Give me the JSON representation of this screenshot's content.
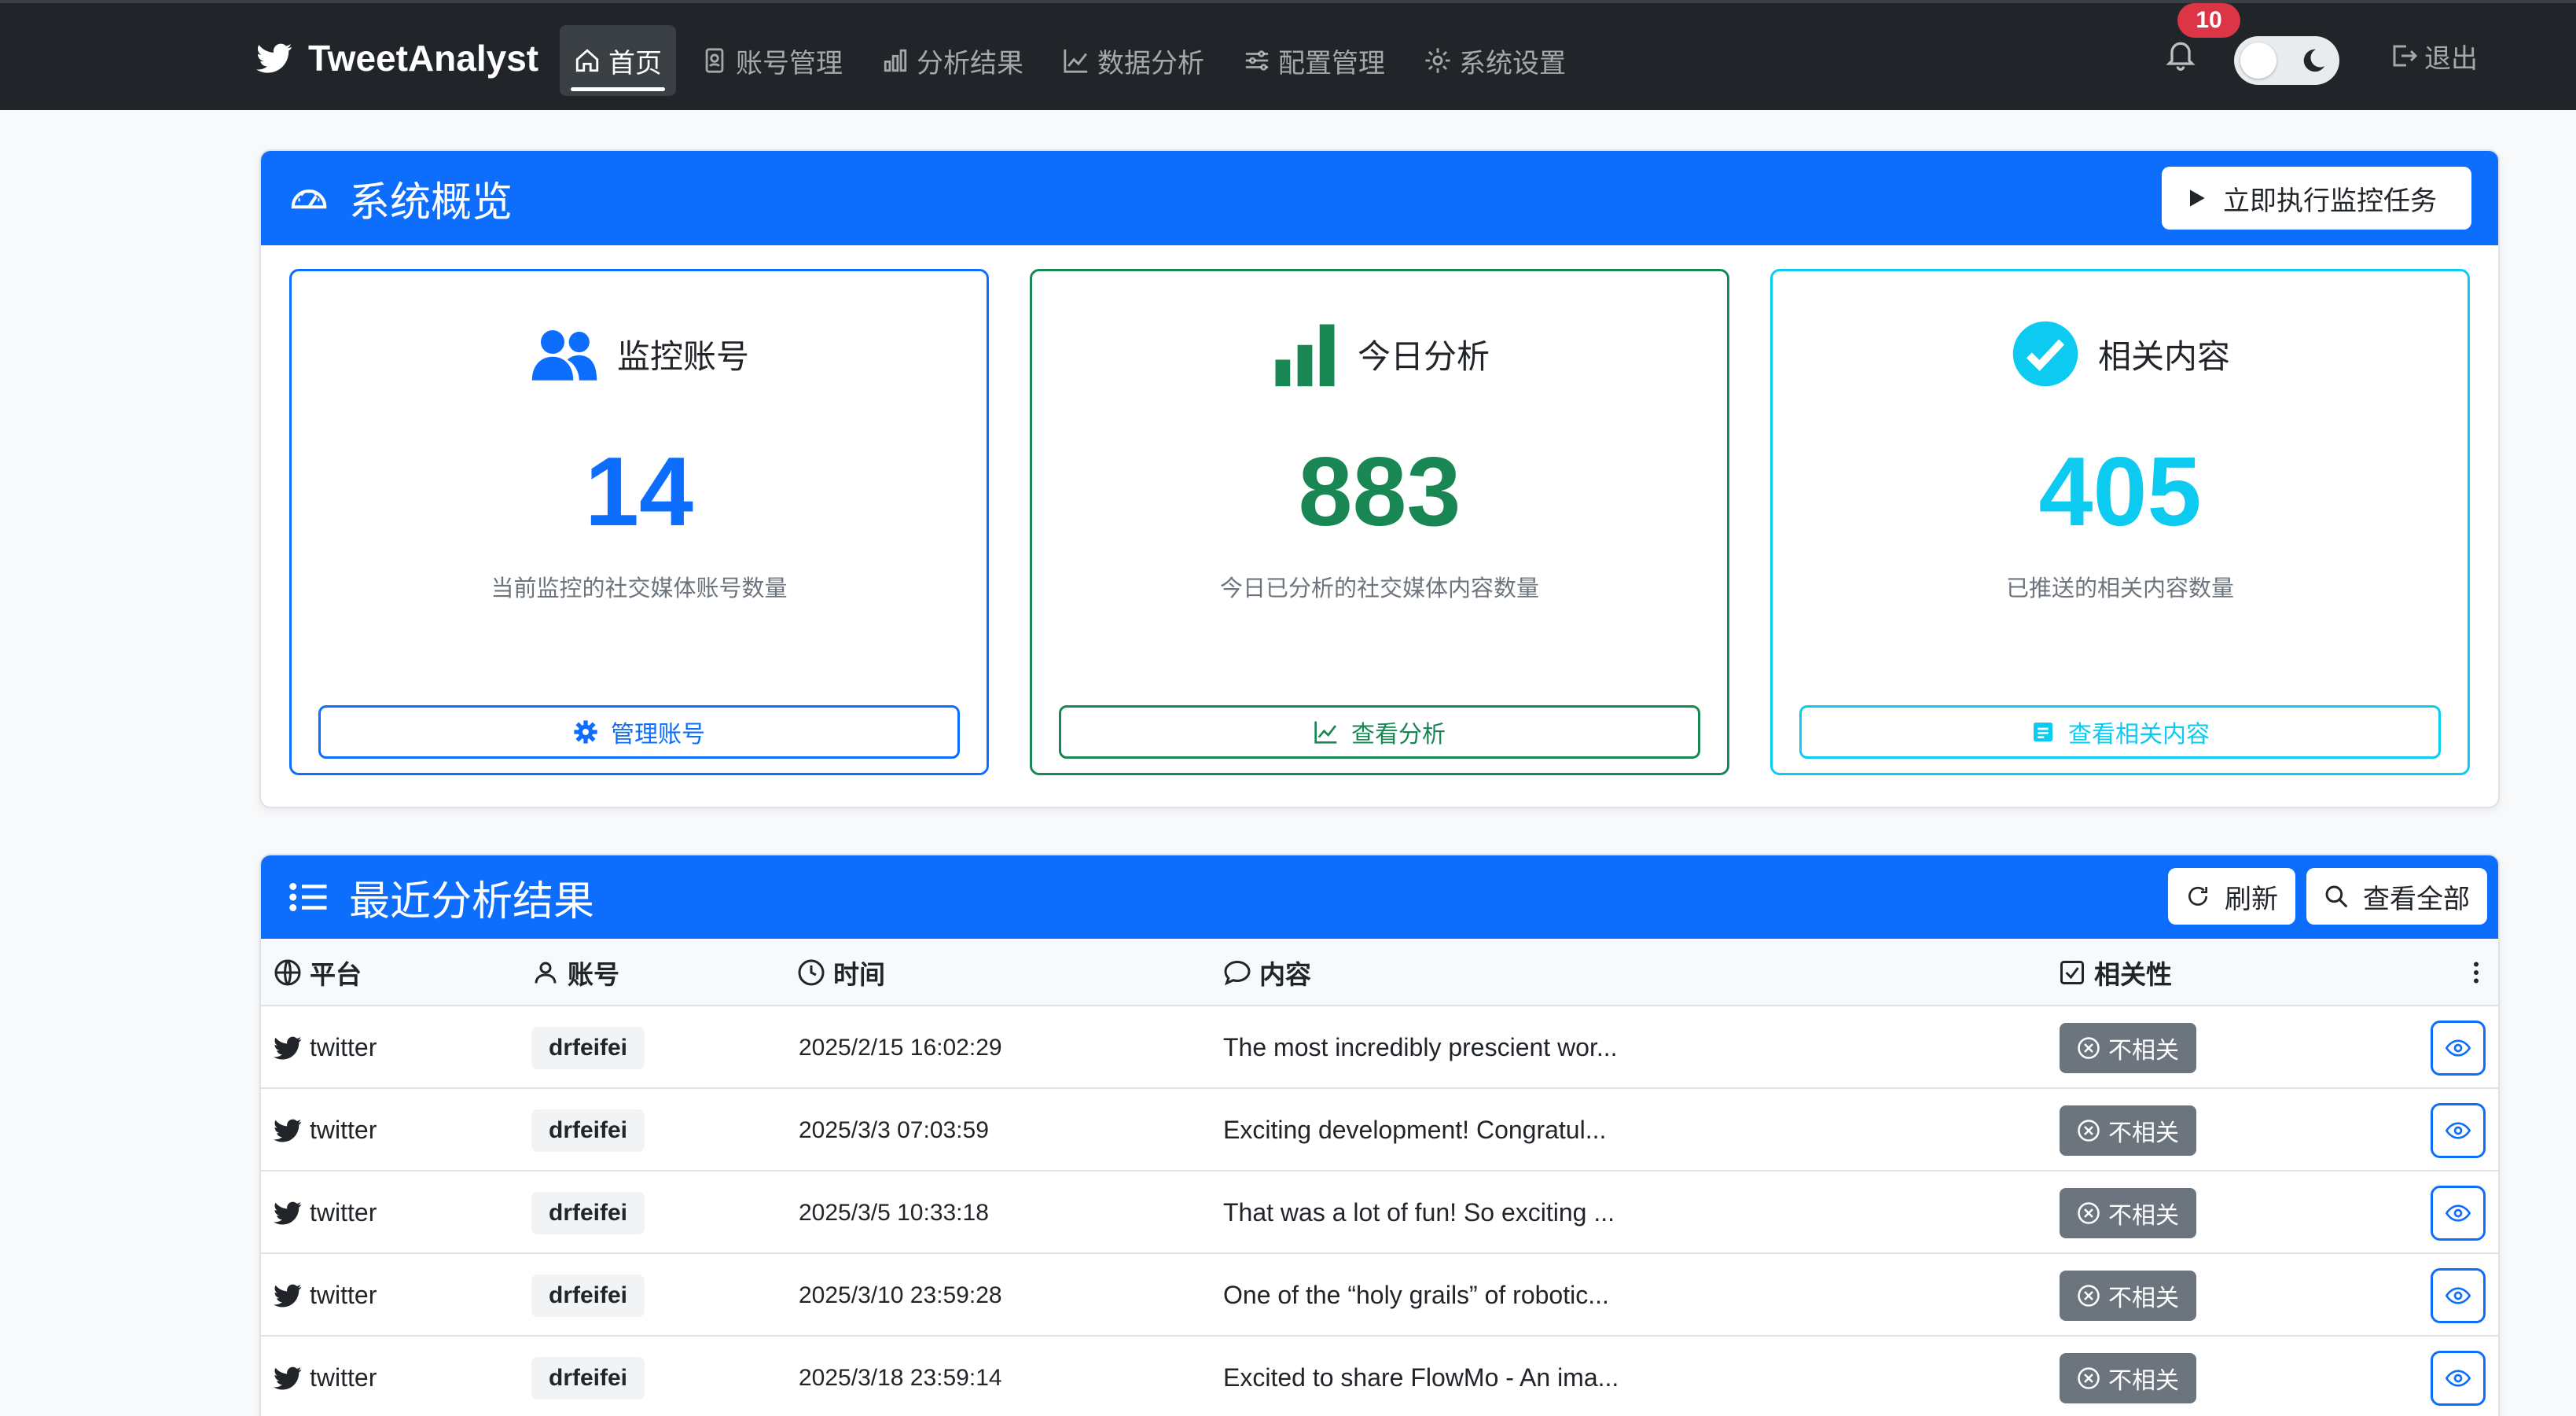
{
  "navbar": {
    "brand": "TweetAnalyst",
    "items": [
      {
        "label": "首页",
        "icon": "house-icon",
        "active": true
      },
      {
        "label": "账号管理",
        "icon": "person-badge-icon"
      },
      {
        "label": "分析结果",
        "icon": "bar-chart-icon"
      },
      {
        "label": "数据分析",
        "icon": "graph-up-icon"
      },
      {
        "label": "配置管理",
        "icon": "sliders-icon"
      },
      {
        "label": "系统设置",
        "icon": "gear-icon"
      }
    ],
    "notification_count": "10",
    "logout": "退出",
    "theme_toggle": "dark-mode-toggle"
  },
  "overview": {
    "title": "系统概览",
    "run_button": "立即执行监控任务",
    "stats": [
      {
        "title": "监控账号",
        "value": "14",
        "desc": "当前监控的社交媒体账号数量",
        "button": "管理账号",
        "color": "#0d6efd",
        "icon": "people-icon"
      },
      {
        "title": "今日分析",
        "value": "883",
        "desc": "今日已分析的社交媒体内容数量",
        "button": "查看分析",
        "color": "#198754",
        "icon": "bar-chart-icon"
      },
      {
        "title": "相关内容",
        "value": "405",
        "desc": "已推送的相关内容数量",
        "button": "查看相关内容",
        "color": "#0dcaf0",
        "icon": "check-circle-icon"
      }
    ]
  },
  "recent": {
    "title": "最近分析结果",
    "refresh": "刷新",
    "view_all": "查看全部",
    "columns": {
      "platform": "平台",
      "account": "账号",
      "time": "时间",
      "content": "内容",
      "relevance": "相关性"
    },
    "rows": [
      {
        "platform": "twitter",
        "account": "drfeifei",
        "time": "2025/2/15 16:02:29",
        "content": "The most incredibly prescient wor...",
        "relevance": "不相关"
      },
      {
        "platform": "twitter",
        "account": "drfeifei",
        "time": "2025/3/3 07:03:59",
        "content": "Exciting development! Congratul...",
        "relevance": "不相关"
      },
      {
        "platform": "twitter",
        "account": "drfeifei",
        "time": "2025/3/5 10:33:18",
        "content": "That was a lot of fun! So exciting ...",
        "relevance": "不相关"
      },
      {
        "platform": "twitter",
        "account": "drfeifei",
        "time": "2025/3/10 23:59:28",
        "content": "One of the “holy grails” of robotic...",
        "relevance": "不相关"
      },
      {
        "platform": "twitter",
        "account": "drfeifei",
        "time": "2025/3/18 23:59:14",
        "content": "Excited to share FlowMo - An ima...",
        "relevance": "不相关"
      }
    ]
  }
}
